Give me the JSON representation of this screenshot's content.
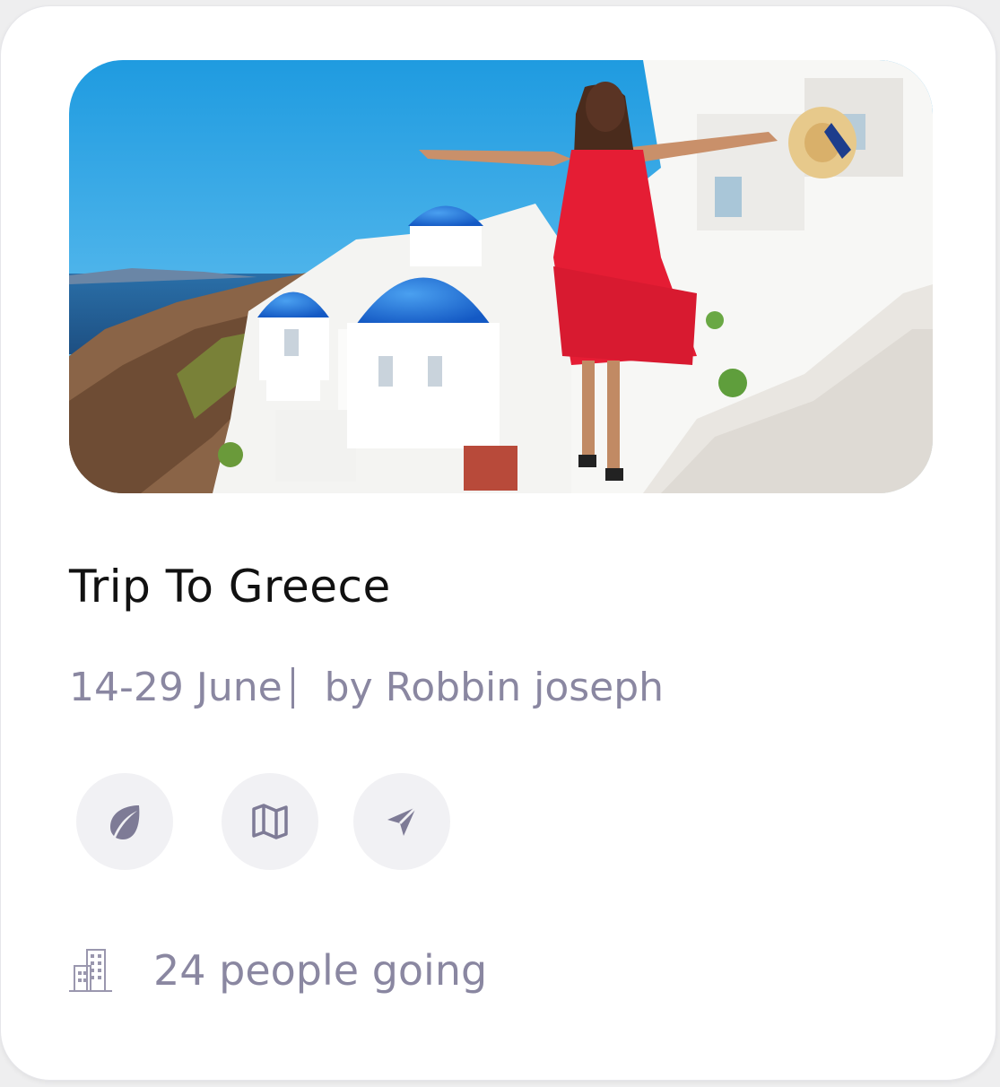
{
  "trip": {
    "title": "Trip To Greece",
    "dates": "14-29 June",
    "author": "by Robbin joseph",
    "attendance": "24 people going"
  },
  "actions": [
    {
      "icon": "leaf-icon"
    },
    {
      "icon": "map-icon"
    },
    {
      "icon": "send-icon"
    }
  ],
  "colors": {
    "card_bg": "#ffffff",
    "muted_text": "#8a87a1",
    "title_text": "#111111",
    "button_bg": "#f1f1f4",
    "icon": "#7e7b96"
  }
}
